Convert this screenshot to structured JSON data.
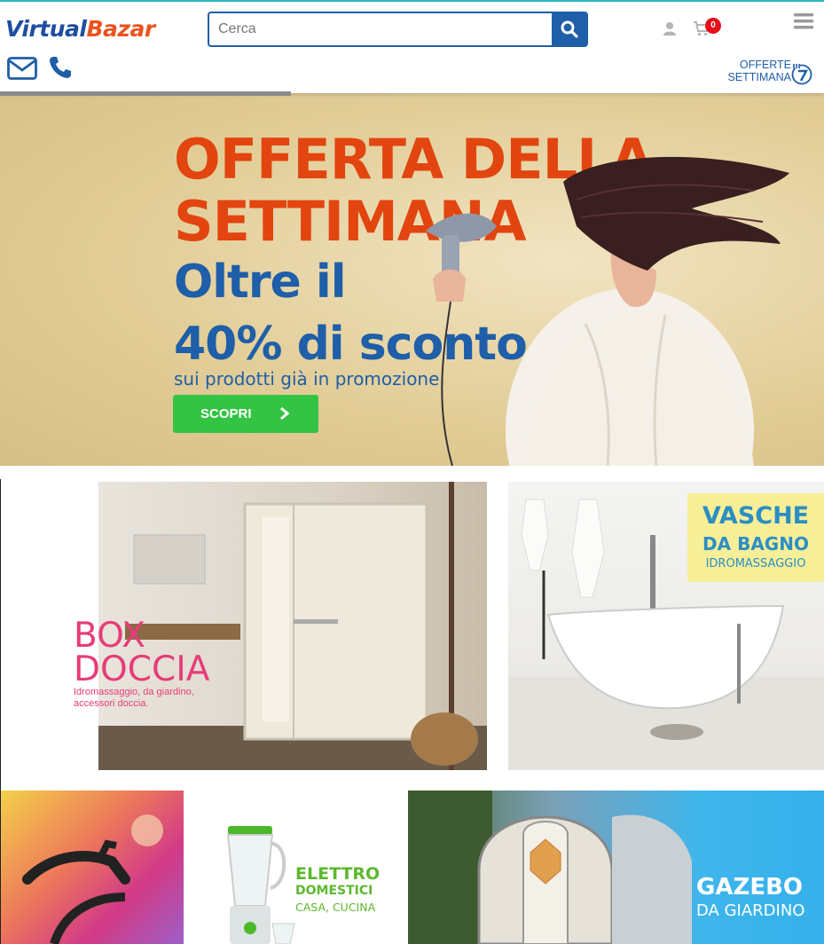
{
  "header": {
    "logo_part1": "Virtual",
    "logo_part2": "Bazar",
    "search_placeholder": "Cerca",
    "cart_count": "0",
    "offers_line1": "OFFERTE",
    "offers_line2": "SETTIMANA",
    "icons": [
      "search-icon",
      "user-icon",
      "cart-icon",
      "menu-icon",
      "mail-icon",
      "phone-icon",
      "calendar-7-icon"
    ]
  },
  "hero": {
    "line1": "OFFERTA DELLA",
    "line2": "SETTIMANA",
    "line3": "Oltre il",
    "line4": "40% di sconto",
    "line5": "sui prodotti già in promozione.",
    "cta": "SCOPRI"
  },
  "tiles": {
    "box_doccia": {
      "title1": "BOX",
      "title2": "DOCCIA",
      "subtitle1": "Idromassaggio, da giardino,",
      "subtitle2": "accessori doccia."
    },
    "vasche": {
      "title1": "VASCHE",
      "title2": "DA BAGNO",
      "title3": "IDROMASSAGGIO"
    },
    "elettro": {
      "title1": "ELETTRO",
      "title2": "DOMESTICI",
      "title3": "CASA, CUCINA"
    },
    "gazebo": {
      "title1": "GAZEBO",
      "title2": "DA GIARDINO"
    }
  },
  "colors": {
    "brand_blue": "#1f5ea8",
    "brand_orange": "#e9531e",
    "cta_green": "#34c444",
    "badge_red": "#e5101a",
    "pink": "#e63c7a"
  }
}
